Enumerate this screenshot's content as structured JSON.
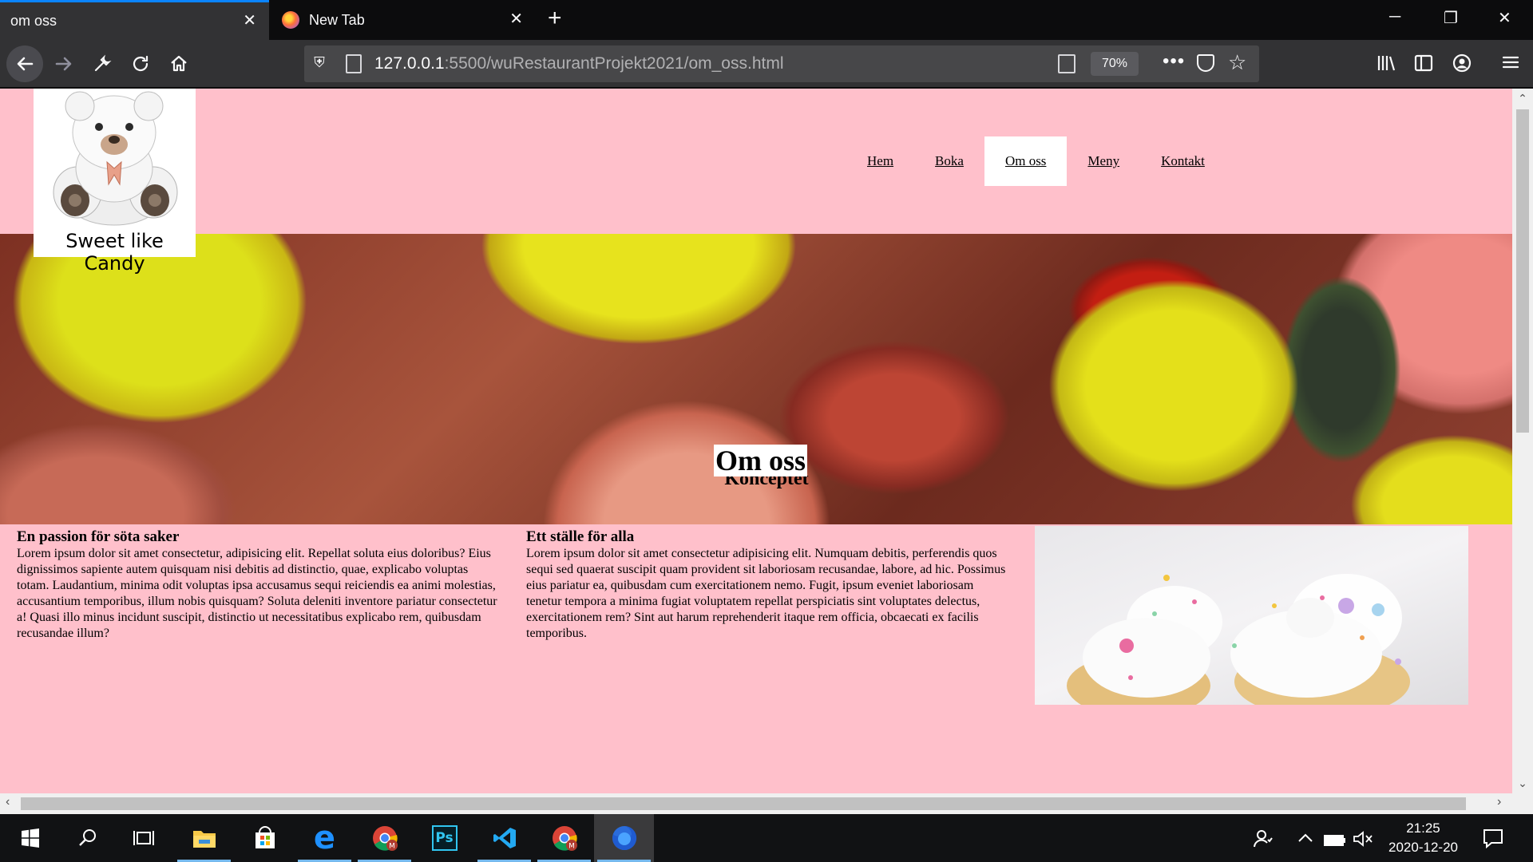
{
  "browser": {
    "tabs": [
      {
        "title": "om oss",
        "active": true
      },
      {
        "title": "New Tab",
        "active": false
      }
    ],
    "url_host": "127.0.0.1",
    "url_path": ":5500/wuRestaurantProjekt2021/om_oss.html",
    "zoom": "70%",
    "toolbar_icons": [
      "back-arrow-icon",
      "forward-arrow-icon",
      "wrench-icon",
      "reload-icon",
      "home-icon",
      "shield-icon",
      "page-info-icon",
      "reader-view-icon",
      "meatball-menu-icon",
      "pocket-icon",
      "bookmark-star-icon",
      "library-icon",
      "sidebar-icon",
      "account-icon",
      "hamburger-menu-icon"
    ]
  },
  "site": {
    "logo_text": "Sweet like Candy",
    "nav": [
      {
        "label": "Hem",
        "active": false
      },
      {
        "label": "Boka",
        "active": false
      },
      {
        "label": "Om oss",
        "active": true
      },
      {
        "label": "Meny",
        "active": false
      },
      {
        "label": "Kontakt",
        "active": false
      }
    ],
    "hero_title": "Om oss",
    "section_title": "Konceptet",
    "columns": [
      {
        "heading": "En passion för söta saker",
        "text": "Lorem ipsum dolor sit amet consectetur, adipisicing elit. Repellat soluta eius doloribus? Eius dignissimos sapiente autem quisquam nisi debitis ad distinctio, quae, explicabo voluptas totam. Laudantium, minima odit voluptas ipsa accusamus sequi reiciendis ea animi molestias, accusantium temporibus, illum nobis quisquam? Soluta deleniti inventore pariatur consectetur a! Quasi illo minus incidunt suscipit, distinctio ut necessitatibus explicabo rem, quibusdam recusandae illum?"
      },
      {
        "heading": "Ett ställe för alla",
        "text": "Lorem ipsum dolor sit amet consectetur adipisicing elit. Numquam debitis, perferendis quos sequi sed quaerat suscipit quam provident sit laboriosam recusandae, labore, ad hic. Possimus eius pariatur ea, quibusdam cum exercitationem nemo. Fugit, ipsum eveniet laboriosam tenetur tempora a minima fugiat voluptatem repellat perspiciatis sint voluptates delectus, exercitationem rem? Sint aut harum reprehenderit itaque rem officia, obcaecati ex facilis temporibus."
      }
    ]
  },
  "taskbar": {
    "apps": [
      "windows-start-icon",
      "search-icon",
      "task-view-icon",
      "file-explorer-icon",
      "microsoft-store-icon",
      "edge-icon",
      "chrome-icon",
      "photoshop-icon",
      "vscode-icon",
      "chrome-icon",
      "firefox-icon"
    ],
    "time": "21:25",
    "date": "2020-12-20"
  },
  "colors": {
    "page_background": "#ffc0cb",
    "browser_dark": "#323234",
    "active_tab_accent": "#0a84ff"
  }
}
